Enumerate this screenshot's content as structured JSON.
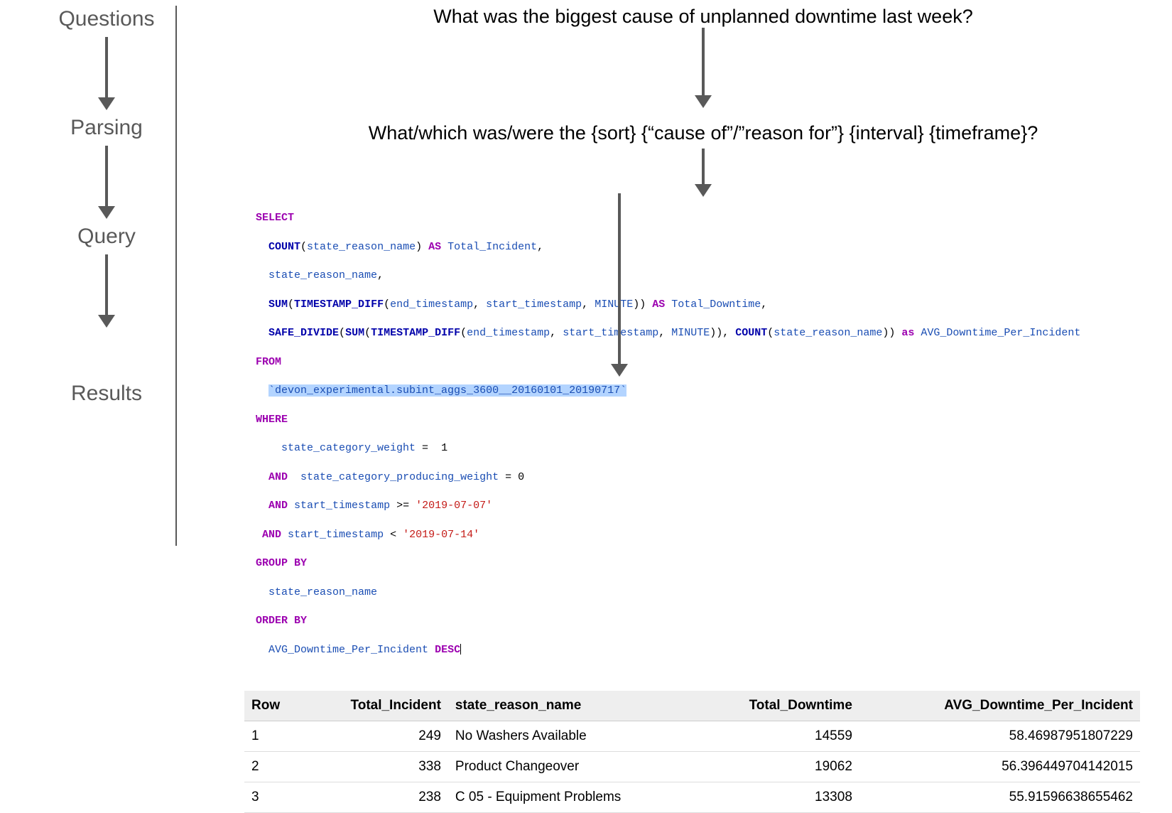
{
  "stages": {
    "questions": "Questions",
    "parsing": "Parsing",
    "query": "Query",
    "results": "Results"
  },
  "question_text": "What was the biggest cause of unplanned downtime last week?",
  "parsing_text": "What/which was/were the {sort} {“cause of”/”reason for”} {interval} {timeframe}?",
  "sql": {
    "select": "SELECT",
    "l1_count": "COUNT",
    "l1_arg": "state_reason_name",
    "l1_as": "AS",
    "l1_alias": "Total_Incident",
    "l2": "state_reason_name",
    "l3_sum": "SUM",
    "l3_func": "TIMESTAMP_DIFF",
    "l3_a1": "end_timestamp",
    "l3_a2": "start_timestamp",
    "l3_unit": "MINUTE",
    "l3_as": "AS",
    "l3_alias": "Total_Downtime",
    "l4_func": "SAFE_DIVIDE",
    "l4_sum": "SUM",
    "l4_td": "TIMESTAMP_DIFF",
    "l4_a1": "end_timestamp",
    "l4_a2": "start_timestamp",
    "l4_unit": "MINUTE",
    "l4_count": "COUNT",
    "l4_carg": "state_reason_name",
    "l4_as": "as",
    "l4_alias": "AVG_Downtime_Per_Incident",
    "from": "FROM",
    "table": "`devon_experimental.subint_aggs_3600__20160101_20190717`",
    "where": "WHERE",
    "w1_col": "state_category_weight",
    "w1_val": "1",
    "and": "AND",
    "w2_col": "state_category_producing_weight",
    "w2_val": "0",
    "w3_col": "start_timestamp",
    "w3_val": "'2019-07-07'",
    "w4_col": "start_timestamp",
    "w4_val": "'2019-07-14'",
    "groupby": "GROUP BY",
    "gb_col": "state_reason_name",
    "orderby": "ORDER BY",
    "ob_col": "AVG_Downtime_Per_Incident",
    "desc": "DESC"
  },
  "table_headers": {
    "row": "Row",
    "ti": "Total_Incident",
    "srn": "state_reason_name",
    "td": "Total_Downtime",
    "avg": "AVG_Downtime_Per_Incident"
  },
  "table_rows": [
    {
      "row": "1",
      "ti": "249",
      "srn": "No Washers Available",
      "td": "14559",
      "avg": "58.46987951807229"
    },
    {
      "row": "2",
      "ti": "338",
      "srn": "Product Changeover",
      "td": "19062",
      "avg": "56.396449704142015"
    },
    {
      "row": "3",
      "ti": "238",
      "srn": "C 05 - Equipment Problems",
      "td": "13308",
      "avg": "55.91596638655462"
    }
  ]
}
